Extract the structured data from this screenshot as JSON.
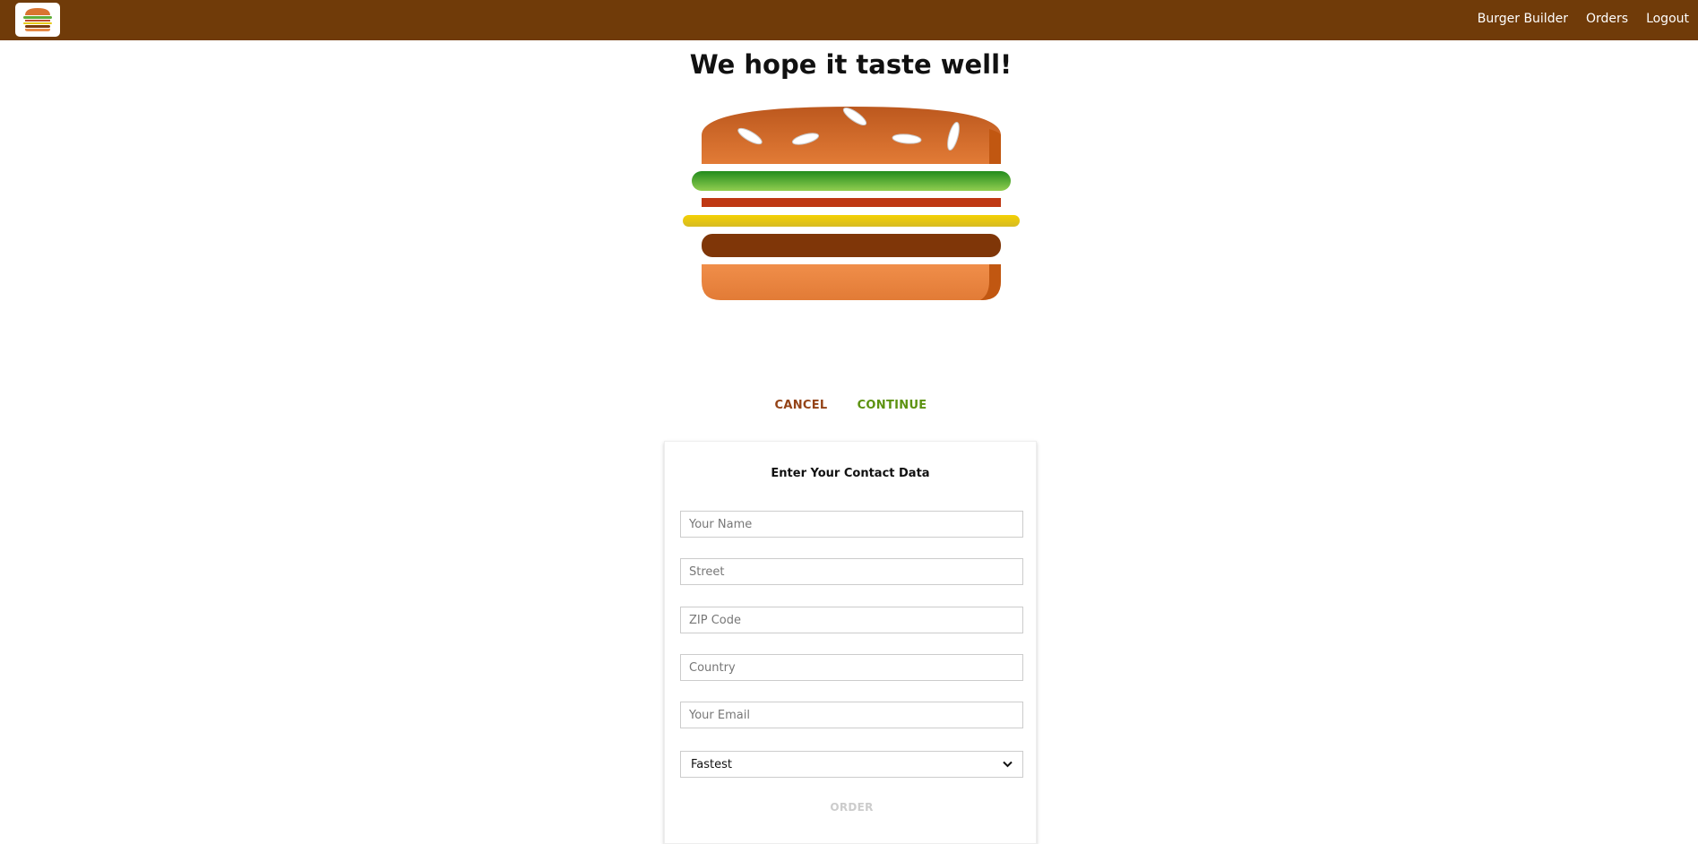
{
  "nav": {
    "logo_alt": "MyBurger",
    "items": [
      {
        "label": "Burger Builder"
      },
      {
        "label": "Orders"
      },
      {
        "label": "Logout"
      }
    ]
  },
  "summary": {
    "title": "We hope it taste well!",
    "ingredients": [
      "salad",
      "bacon",
      "cheese",
      "meat"
    ],
    "cancel_label": "CANCEL",
    "continue_label": "CONTINUE"
  },
  "contact": {
    "heading": "Enter Your Contact Data",
    "fields": [
      {
        "placeholder": "Your Name"
      },
      {
        "placeholder": "Street"
      },
      {
        "placeholder": "ZIP Code"
      },
      {
        "placeholder": "Country"
      },
      {
        "placeholder": "Your Email"
      }
    ],
    "delivery_method": "Fastest",
    "order_label": "ORDER"
  },
  "colors": {
    "toolbar": "#703B09",
    "cancel": "#944317",
    "continue": "#5C9210",
    "disabled": "#cccccc"
  }
}
